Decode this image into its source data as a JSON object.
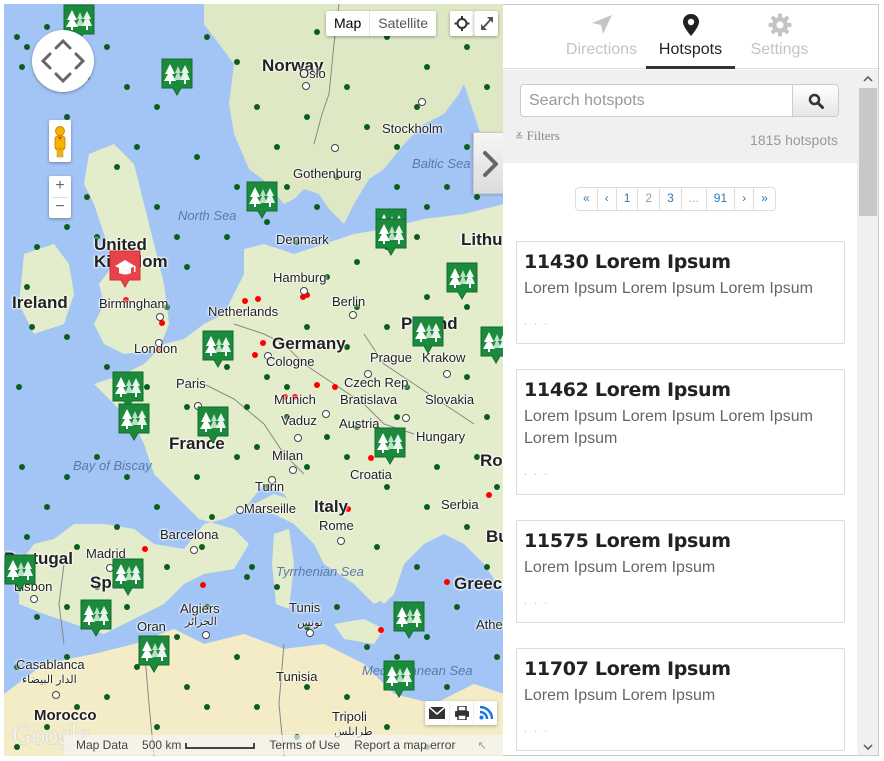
{
  "map": {
    "type_buttons": [
      {
        "label": "Map",
        "active": true
      },
      {
        "label": "Satellite",
        "active": false
      }
    ],
    "zoom_in": "+",
    "zoom_out": "−",
    "attribution": {
      "map_data": "Map Data",
      "scale": "500 km",
      "terms": "Terms of Use",
      "report": "Report a map error"
    },
    "logo": "Google",
    "labels": {
      "countries": [
        "Norway",
        "United Kingdom",
        "Ireland",
        "Netherlands",
        "Germany",
        "Poland",
        "Czech Rep",
        "Slovakia",
        "Austria",
        "Hungary",
        "France",
        "Italy",
        "Croatia",
        "Spain",
        "Portugal",
        "Greece",
        "Lithuania",
        "Romania",
        "Bulgaria",
        "Serbia",
        "Tunisia",
        "Morocco",
        "Denmark"
      ],
      "cities": [
        "Oslo",
        "Stockholm",
        "Gothenburg",
        "Hamburg",
        "Berlin",
        "Birmingham",
        "London",
        "Cologne",
        "Prague",
        "Krakow",
        "Munich",
        "Bratislava",
        "Vaduz",
        "Paris",
        "Milan",
        "Turin",
        "Marseille",
        "Rome",
        "Barcelona",
        "Madrid",
        "Lisbon",
        "Algiers",
        "Oran",
        "Tunis",
        "Casablanca",
        "Tripoli",
        "Athens"
      ],
      "seas": [
        "North Sea",
        "Baltic Sea",
        "Bay of Biscay",
        "Tyrrhenian Sea",
        "Mediterranean Sea"
      ],
      "arabic": {
        "algiers": "الجزائر",
        "tunis": "تونس",
        "casablanca": "الدار البيضاء",
        "tripoli": "طرابلس"
      }
    },
    "colors": {
      "water": "#a3c5f5",
      "land": "#e3eccb",
      "hotspot_dot": "#0d5d20",
      "red_dot": "#ff0000",
      "forest_pin": "#1b8a3c",
      "school_pin": "#e8434b"
    }
  },
  "sidebar": {
    "tabs": [
      {
        "label": "Directions",
        "icon": "navigation-arrow-icon",
        "active": false
      },
      {
        "label": "Hotspots",
        "icon": "map-marker-icon",
        "active": true
      },
      {
        "label": "Settings",
        "icon": "gear-icon",
        "active": false
      }
    ],
    "search": {
      "placeholder": "Search hotspots",
      "value": ""
    },
    "filters_label": "Filters",
    "count_label": "1815 hotspots",
    "pagination": [
      "«",
      "‹",
      "1",
      "2",
      "3",
      "...",
      "91",
      "›",
      "»"
    ],
    "current_page": "2",
    "items": [
      {
        "title": "11430 Lorem Ipsum",
        "description": "Lorem Ipsum Lorem Ipsum Lorem Ipsum",
        "more": ". . ."
      },
      {
        "title": "11462 Lorem Ipsum",
        "description": "Lorem Ipsum Lorem Ipsum Lorem Ipsum Lorem Ipsum",
        "more": ". . ."
      },
      {
        "title": "11575 Lorem Ipsum",
        "description": "Lorem Ipsum Lorem Ipsum",
        "more": ". . ."
      },
      {
        "title": "11707 Lorem Ipsum",
        "description": "Lorem Ipsum Lorem Ipsum",
        "more": ". . ."
      }
    ]
  }
}
